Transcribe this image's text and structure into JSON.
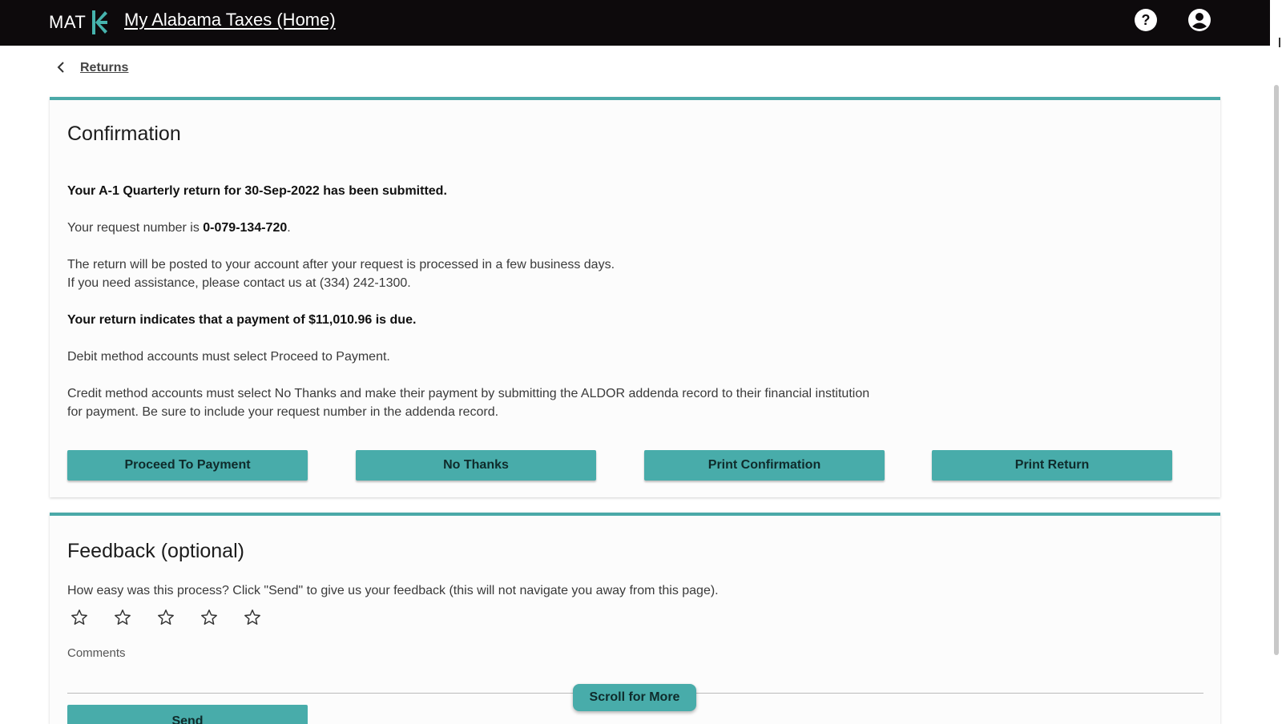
{
  "header": {
    "brand_text": "MAT",
    "home_link": "My Alabama Taxes (Home)",
    "help_icon": "help-circle-icon",
    "account_icon": "account-circle-icon"
  },
  "breadcrumb": {
    "back_icon": "chevron-left-icon",
    "link": "Returns"
  },
  "confirmation": {
    "title": "Confirmation",
    "submitted_text": "Your A-1 Quarterly return for 30-Sep-2022 has been submitted.",
    "request_prefix": "Your request number is ",
    "request_number": "0-079-134-720",
    "request_suffix": ".",
    "posted_text": "The return will be posted to your account after your request is processed in a few business days.",
    "assistance_text": "If you need assistance, please contact us at (334) 242-1300.",
    "payment_due_text": "Your return indicates that a payment of $11,010.96 is due.",
    "debit_text": "Debit method accounts must select Proceed to Payment.",
    "credit_text_1": "Credit method accounts must select No Thanks and make their payment by submitting the ALDOR addenda record to their financial institution",
    "credit_text_2": "for payment. Be sure to include your request number in the addenda record.",
    "buttons": {
      "proceed": "Proceed To Payment",
      "no_thanks": "No Thanks",
      "print_confirmation": "Print Confirmation",
      "print_return": "Print Return"
    }
  },
  "feedback": {
    "title": "Feedback (optional)",
    "prompt": "How easy was this process? Click \"Send\" to give us your feedback (this will not navigate you away from this page).",
    "rating": 0,
    "rating_max": 5,
    "star_icon": "star-outline-icon",
    "comments_label": "Comments",
    "comments_value": "",
    "send_button": "Send"
  },
  "scroll_more_button": "Scroll for More",
  "colors": {
    "topbar": "#0d0a0c",
    "accent": "#48acaa",
    "card_border": "#4aa9a8"
  }
}
